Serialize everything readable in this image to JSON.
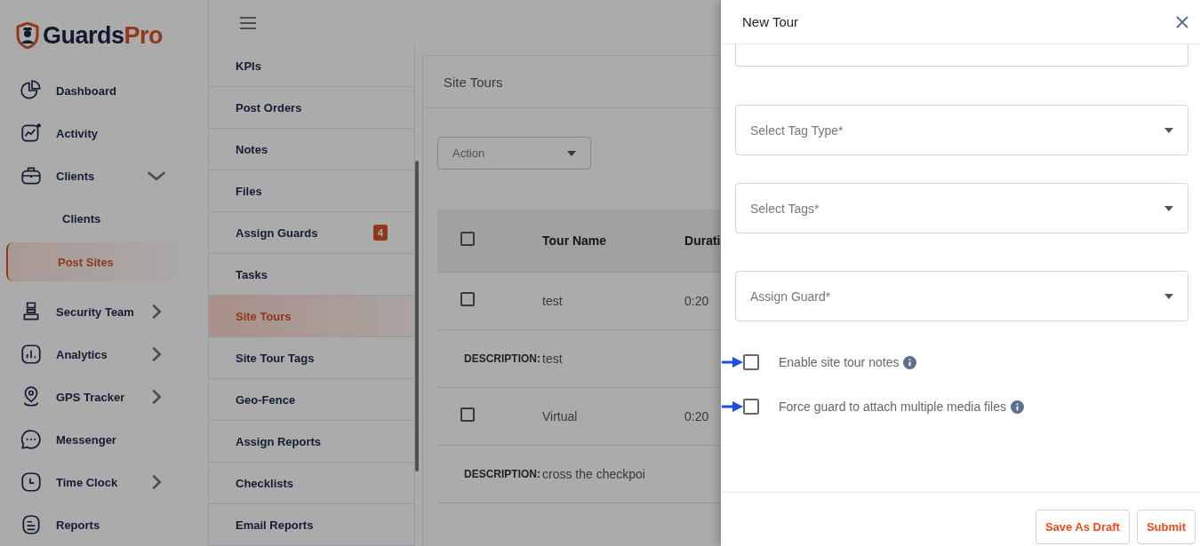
{
  "brand": {
    "name_part_1": "Guards",
    "name_part_2": "Pro"
  },
  "sidebar": {
    "items": [
      {
        "label": "Dashboard"
      },
      {
        "label": "Activity"
      },
      {
        "label": "Clients",
        "expanded": true,
        "children": [
          {
            "label": "Clients",
            "selected": false
          },
          {
            "label": "Post Sites",
            "selected": true
          }
        ]
      },
      {
        "label": "Security Team",
        "expanded": false
      },
      {
        "label": "Analytics",
        "expanded": false
      },
      {
        "label": "GPS Tracker",
        "expanded": false
      },
      {
        "label": "Messenger"
      },
      {
        "label": "Time Clock",
        "expanded": false
      },
      {
        "label": "Reports"
      }
    ]
  },
  "submenu": {
    "items": [
      {
        "label": "KPIs",
        "selected": false
      },
      {
        "label": "Post Orders",
        "selected": false
      },
      {
        "label": "Notes",
        "selected": false
      },
      {
        "label": "Files",
        "selected": false
      },
      {
        "label": "Assign Guards",
        "selected": false,
        "badge": "4"
      },
      {
        "label": "Tasks",
        "selected": false
      },
      {
        "label": "Site Tours",
        "selected": true
      },
      {
        "label": "Site Tour Tags",
        "selected": false
      },
      {
        "label": "Geo-Fence",
        "selected": false
      },
      {
        "label": "Assign Reports",
        "selected": false
      },
      {
        "label": "Checklists",
        "selected": false
      },
      {
        "label": "Email Reports",
        "selected": false
      }
    ]
  },
  "main": {
    "title": "Site Tours",
    "action_dropdown": {
      "placeholder": "Action"
    },
    "table": {
      "columns": [
        "Tour Name",
        "Durati"
      ],
      "header_checked": false,
      "rows": [
        {
          "checked": false,
          "cells": [
            "test",
            "0:20"
          ],
          "description_label": "DESCRIPTION:",
          "description": "test"
        },
        {
          "checked": false,
          "cells": [
            "Virtual",
            "0:20"
          ],
          "description_label": "DESCRIPTION:",
          "description": "cross the checkpoi"
        }
      ]
    }
  },
  "drawer": {
    "title": "New Tour",
    "selects": [
      {
        "placeholder": "Select Tag Type*"
      },
      {
        "placeholder": "Select Tags*"
      },
      {
        "placeholder": "Assign Guard*"
      }
    ],
    "options": [
      {
        "label": "Enable site tour notes",
        "checked": false
      },
      {
        "label": "Force guard to attach multiple media files",
        "checked": false
      }
    ],
    "buttons": [
      "Save As Draft",
      "Submit"
    ]
  }
}
